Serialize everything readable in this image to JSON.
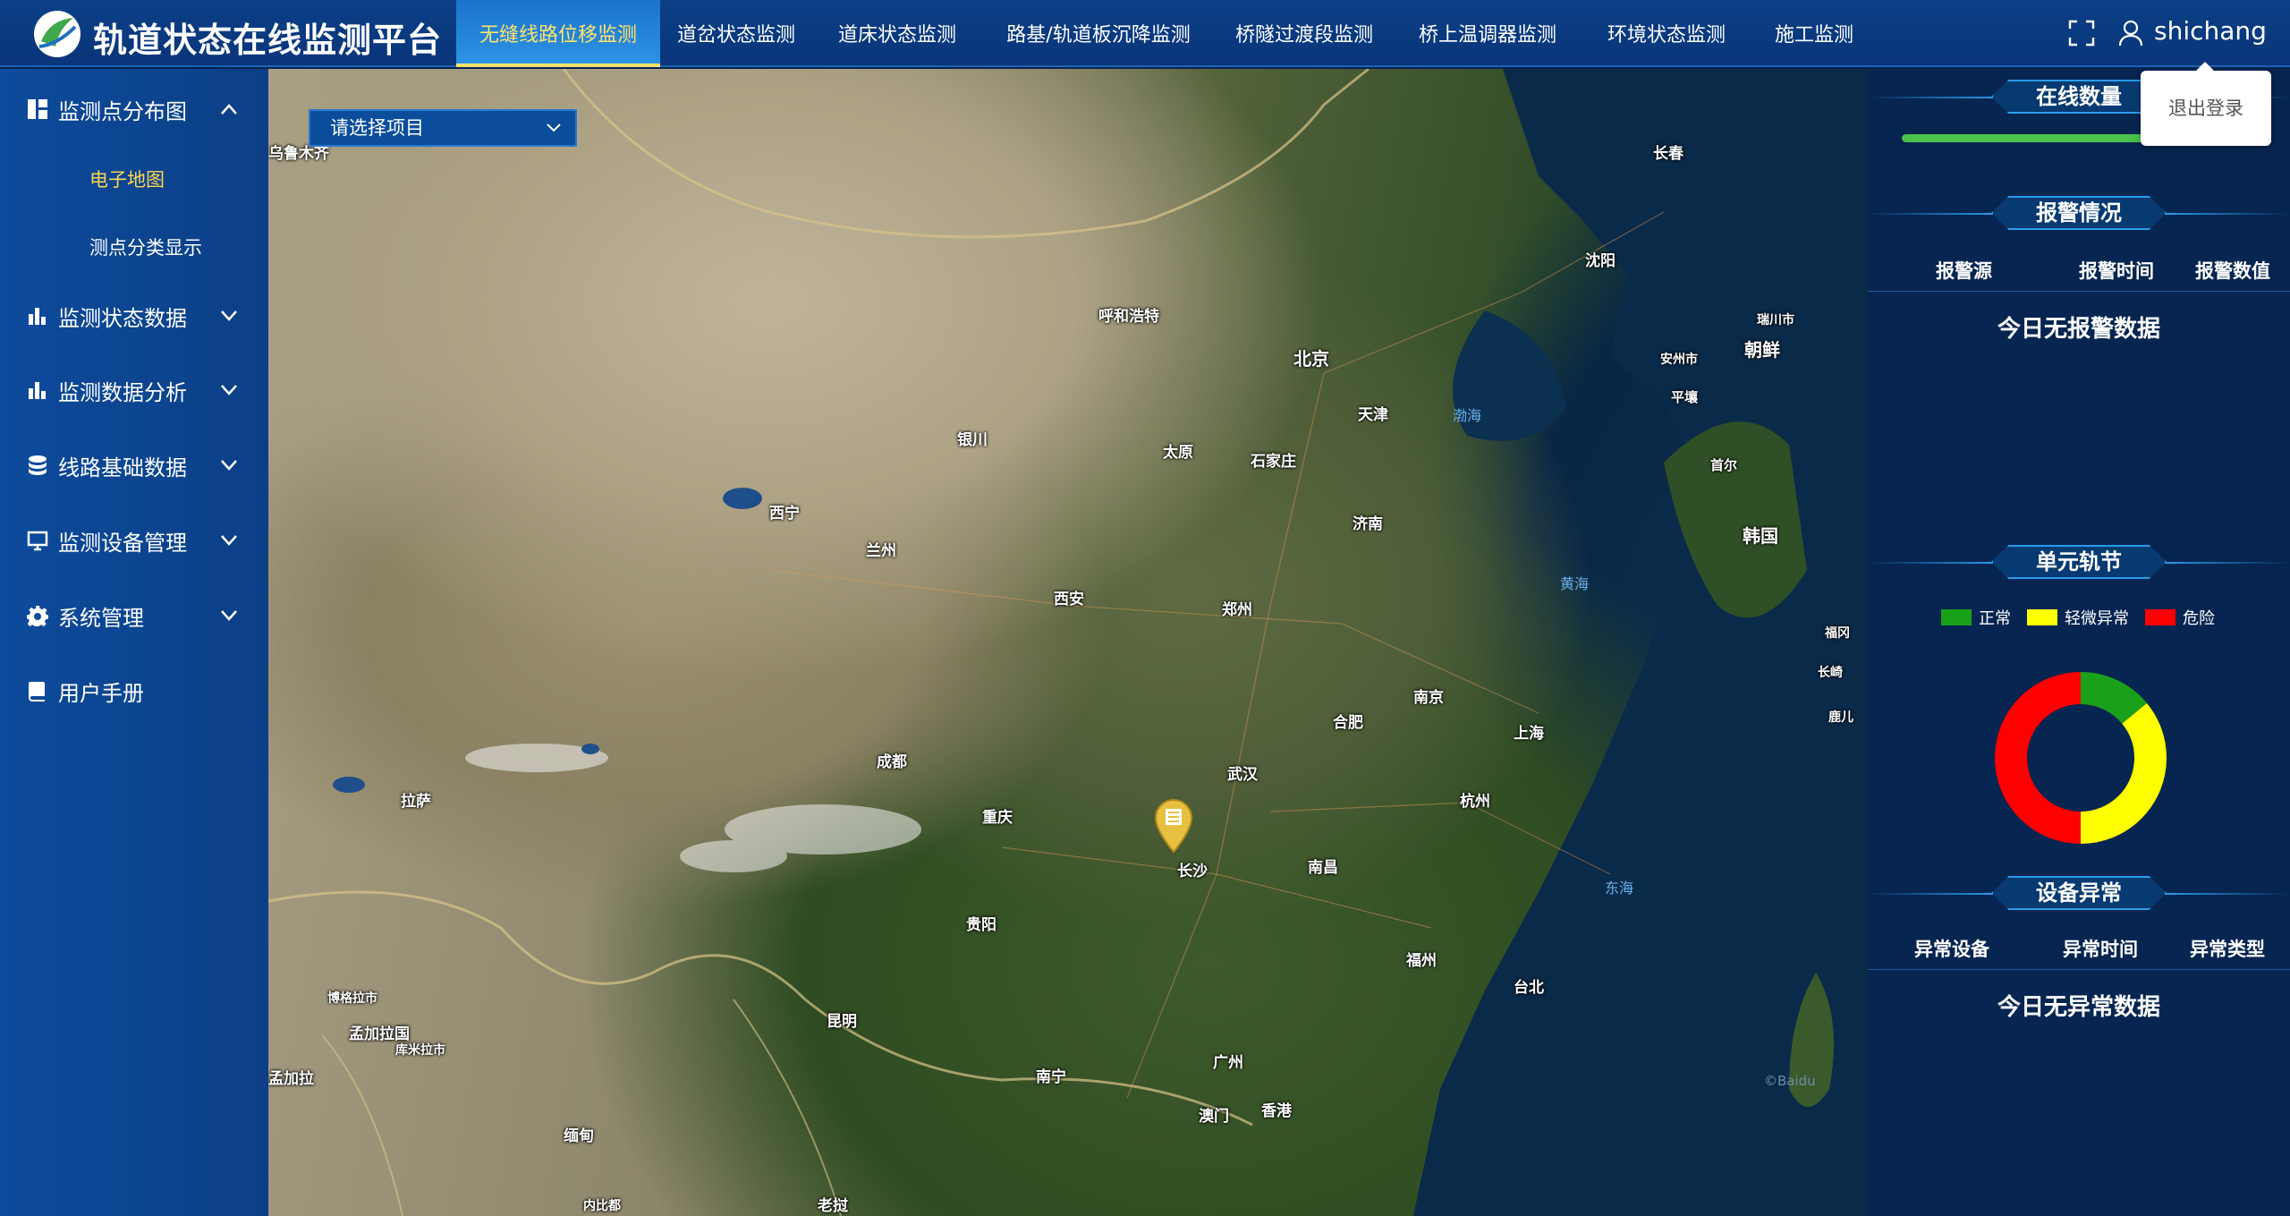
{
  "header": {
    "title": "轨道状态在线监测平台",
    "nav": [
      {
        "label": "无缝线路位移监测",
        "active": true
      },
      {
        "label": "道岔状态监测"
      },
      {
        "label": "道床状态监测"
      },
      {
        "label": "路基/轨道板沉降监测"
      },
      {
        "label": "桥隧过渡段监测"
      },
      {
        "label": "桥上温调器监测"
      },
      {
        "label": "环境状态监测"
      },
      {
        "label": "施工监测"
      }
    ],
    "username": "shichang",
    "logout": "退出登录"
  },
  "sidebar": {
    "items": [
      {
        "label": "监测点分布图",
        "icon": "dashboard-icon",
        "expanded": true,
        "children": [
          {
            "label": "电子地图",
            "active": true
          },
          {
            "label": "测点分类显示"
          }
        ]
      },
      {
        "label": "监测状态数据",
        "icon": "bar-chart-icon"
      },
      {
        "label": "监测数据分析",
        "icon": "bar-chart-icon"
      },
      {
        "label": "线路基础数据",
        "icon": "database-icon"
      },
      {
        "label": "监测设备管理",
        "icon": "monitor-icon"
      },
      {
        "label": "系统管理",
        "icon": "gear-icon"
      },
      {
        "label": "用户手册",
        "icon": "book-icon"
      }
    ]
  },
  "map": {
    "project_select_placeholder": "请选择项目",
    "cities": [
      "乌鲁木齐",
      "长春",
      "沈阳",
      "呼和浩特",
      "北京",
      "天津",
      "银川",
      "太原",
      "石家庄",
      "西宁",
      "兰州",
      "济南",
      "西安",
      "郑州",
      "南京",
      "合肥",
      "上海",
      "成都",
      "武汉",
      "重庆",
      "杭州",
      "长沙",
      "南昌",
      "贵阳",
      "福州",
      "台北",
      "昆明",
      "南宁",
      "广州",
      "澳门",
      "香港",
      "拉萨",
      "朝鲜",
      "韩国",
      "首尔",
      "平壤",
      "安州市",
      "瑞川市",
      "福冈",
      "长崎",
      "鹿儿",
      "孟加拉国",
      "博格拉市",
      "库米拉市",
      "缅甸",
      "老挝",
      "内比都",
      "孟加拉"
    ],
    "seas": [
      "渤海",
      "黄海",
      "东海"
    ],
    "watermark": "©Baidu"
  },
  "right_panel": {
    "online": {
      "title": "在线数量",
      "progress": 1.0
    },
    "alarm": {
      "title": "报警情况",
      "columns": [
        "报警源",
        "报警时间",
        "报警数值"
      ],
      "empty": "今日无报警数据"
    },
    "rail_unit": {
      "title": "单元轨节",
      "legend": [
        {
          "label": "正常",
          "color": "#1aa11a"
        },
        {
          "label": "轻微异常",
          "color": "#ffff00"
        },
        {
          "label": "危险",
          "color": "#ff0000"
        }
      ],
      "donut": [
        {
          "label": "正常",
          "value": 0.14,
          "color": "#1aa11a"
        },
        {
          "label": "轻微异常",
          "value": 0.36,
          "color": "#ffff00"
        },
        {
          "label": "危险",
          "value": 0.5,
          "color": "#ff0000"
        }
      ]
    },
    "device": {
      "title": "设备异常",
      "columns": [
        "异常设备",
        "异常时间",
        "异常类型"
      ],
      "empty": "今日无异常数据"
    }
  }
}
